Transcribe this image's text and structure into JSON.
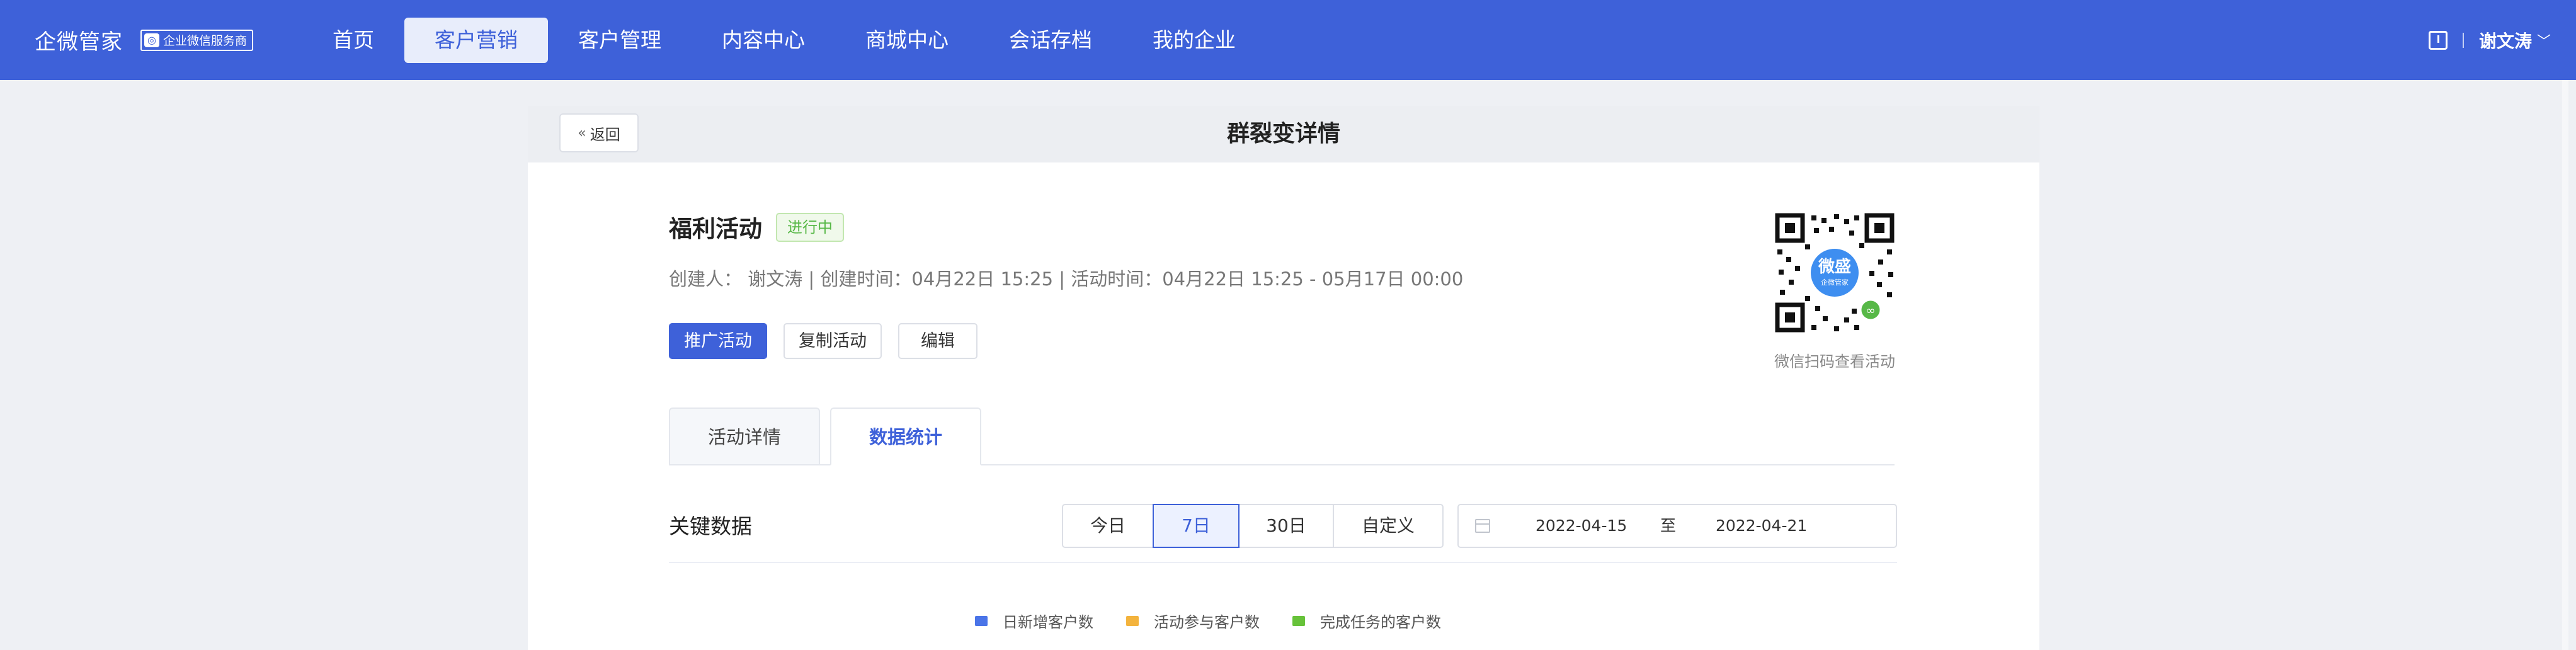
{
  "app": {
    "brand": "企微管家",
    "badge": "企业微信服务商"
  },
  "nav": {
    "items": [
      "首页",
      "客户营销",
      "客户管理",
      "内容中心",
      "商城中心",
      "会话存档",
      "我的企业"
    ],
    "active_index": 1
  },
  "user": {
    "name": "谢文涛"
  },
  "page": {
    "back_label": "返回",
    "title": "群裂变详情"
  },
  "activity": {
    "name": "福利活动",
    "status": "进行中",
    "meta": "创建人： 谢文涛 | 创建时间：04月22日 15:25 | 活动时间：04月22日 15:25 - 05月17日 00:00",
    "buttons": {
      "promote": "推广活动",
      "copy": "复制活动",
      "edit": "编辑"
    },
    "qr_caption": "微信扫码查看活动",
    "qr_center_text": "微盛",
    "qr_center_sub": "企微管家"
  },
  "tabs": [
    "活动详情",
    "数据统计"
  ],
  "active_tab": 1,
  "stats": {
    "title": "关键数据",
    "ranges": [
      "今日",
      "7日",
      "30日",
      "自定义"
    ],
    "active_range": 1,
    "date_start": "2022-04-15",
    "date_to": "至",
    "date_end": "2022-04-21"
  },
  "legend": [
    {
      "label": "日新增客户数",
      "color": "#4a74e8"
    },
    {
      "label": "活动参与客户数",
      "color": "#f3b33d"
    },
    {
      "label": "完成任务的客户数",
      "color": "#67c23a"
    }
  ],
  "colors": {
    "primary": "#3e61d9",
    "success": "#57b847"
  }
}
